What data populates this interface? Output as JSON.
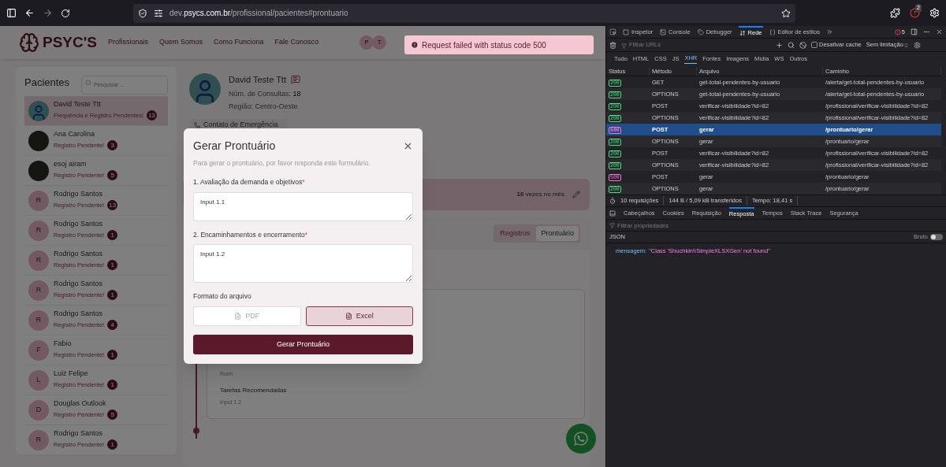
{
  "browser": {
    "url": "dev.**psycs.com.br**/profissional/pacientes#prontuario",
    "notification_count": "2"
  },
  "header": {
    "logo": "PSYC'S",
    "nav": [
      "Profissionais",
      "Quem Somos",
      "Como Funciona",
      "Fale Conosco"
    ],
    "avatars": [
      "P",
      "T"
    ]
  },
  "toast": {
    "message": "Request failed with status code 500"
  },
  "sidebar": {
    "title": "Pacientes",
    "search": {
      "placeholder": "Pesquisar ..."
    },
    "patients": [
      {
        "name": "David Teste Ttt",
        "status": "Frequência e Registro Pendentes!",
        "count": "13",
        "selected": true,
        "kind": "avatar"
      },
      {
        "name": "Ana Carolina",
        "status": "Registro Pendente!",
        "count": "3",
        "selected": false,
        "kind": "photo"
      },
      {
        "name": "esoj airam",
        "status": "Registro Pendente!",
        "count": "5",
        "selected": false,
        "kind": "photo"
      },
      {
        "name": "Rodrigo Santos",
        "status": "Registro Pendente!",
        "count": "13",
        "selected": false,
        "kind": "initial",
        "initial": "R"
      },
      {
        "name": "Rodrigo Santos",
        "status": "Registro Pendente!",
        "count": "1",
        "selected": false,
        "kind": "initial",
        "initial": "R"
      },
      {
        "name": "Rodrigo Santos",
        "status": "Registro Pendente!",
        "count": "1",
        "selected": false,
        "kind": "initial",
        "initial": "R"
      },
      {
        "name": "Rodrigo Santos",
        "status": "Registro Pendente!",
        "count": "1",
        "selected": false,
        "kind": "initial",
        "initial": "R"
      },
      {
        "name": "Rodrigo Santos",
        "status": "Registro Pendente!",
        "count": "4",
        "selected": false,
        "kind": "initial",
        "initial": "R"
      },
      {
        "name": "Fabio",
        "status": "Registro Pendente!",
        "count": "1",
        "selected": false,
        "kind": "initial",
        "initial": "F"
      },
      {
        "name": "Luiz Felipe",
        "status": "Registro Pendente!",
        "count": "1",
        "selected": false,
        "kind": "initial",
        "initial": "L"
      },
      {
        "name": "Douglas Outlook",
        "status": "Registro Pendente!",
        "count": "5",
        "selected": false,
        "kind": "initial",
        "initial": "D"
      },
      {
        "name": "Rodrigo Santos",
        "status": "Registro Pendente!",
        "count": "1",
        "selected": false,
        "kind": "initial",
        "initial": "R"
      }
    ]
  },
  "patient": {
    "name": "David Teste Ttt",
    "consultas_label": "Núm. de Consultas:",
    "consultas": "18",
    "region": "Região: Centro-Oeste",
    "emergency": "Contato de Emergência"
  },
  "frequency": {
    "count": "10",
    "label": "vezes no mês"
  },
  "tabs": [
    {
      "label": "Registros",
      "selected": false
    },
    {
      "label": "Prontuário",
      "selected": true
    }
  ],
  "record": {
    "value": "Ruim",
    "field": "Tarefas Recomendadas",
    "field_value": "Input 1.2"
  },
  "modal": {
    "title": "Gerar Prontuário",
    "subtitle": "Para gerar o prontuário, por favor responda este formulário.",
    "questions": [
      {
        "label": "1. Avaliação da demanda e objetivos",
        "required": true,
        "value": "Input 1.1"
      },
      {
        "label": "2. Encaminhamentos e encerramento",
        "required": true,
        "value": "Input 1.2"
      }
    ],
    "format_label": "Formato do arquivo",
    "formats": [
      {
        "label": "PDF",
        "selected": false
      },
      {
        "label": "Excel",
        "selected": true
      }
    ],
    "submit": "Gerar Prontuário",
    "required_mark": "*"
  },
  "devtools": {
    "tabs": [
      {
        "label": "Inspetor",
        "kind": "inspector",
        "selected": false
      },
      {
        "label": "Console",
        "kind": "console",
        "selected": false
      },
      {
        "label": "Debugger",
        "kind": "debugger",
        "selected": false
      },
      {
        "label": "Rede",
        "kind": "network",
        "selected": true
      },
      {
        "label": "Editor de estilos",
        "kind": "style",
        "selected": false
      }
    ],
    "errors": "5",
    "filter": {
      "placeholder": "Filtrar URLs"
    },
    "disable_cache": {
      "label": "Desativar cache",
      "checked": false
    },
    "throttle": "Sem limitação",
    "types": [
      {
        "label": "Tudo",
        "selected": false
      },
      {
        "label": "HTML",
        "selected": false
      },
      {
        "label": "CSS",
        "selected": false
      },
      {
        "label": "JS",
        "selected": false
      },
      {
        "label": "XHR",
        "selected": true
      },
      {
        "label": "Fontes",
        "selected": false
      },
      {
        "label": "Imagens",
        "selected": false
      },
      {
        "label": "Mídia",
        "selected": false
      },
      {
        "label": "WS",
        "selected": false
      },
      {
        "label": "Outros",
        "selected": false
      }
    ],
    "columns": [
      "Status",
      "Método",
      "Arquivo",
      "Caminho"
    ],
    "requests": [
      {
        "status": "200",
        "color": "#4ade80",
        "method": "GET",
        "file": "get-total-pendentes-by-usuario",
        "path": "/alerta/get-total-pendentes-by-usuario",
        "selected": false
      },
      {
        "status": "200",
        "color": "#4ade80",
        "method": "OPTIONS",
        "file": "get-total-pendentes-by-usuario",
        "path": "/alerta/get-total-pendentes-by-usuario",
        "selected": false
      },
      {
        "status": "200",
        "color": "#4ade80",
        "method": "POST",
        "file": "verificar-visibilidade?id=82",
        "path": "/profissional/verificar-visibilidade?id=82",
        "selected": false
      },
      {
        "status": "200",
        "color": "#4ade80",
        "method": "OPTIONS",
        "file": "verificar-visibilidade?id=82",
        "path": "/profissional/verificar-visibilidade?id=82",
        "selected": false
      },
      {
        "status": "500",
        "color": "#f472d0",
        "method": "POST",
        "file": "gerar",
        "path": "/prontuario/gerar",
        "selected": true
      },
      {
        "status": "200",
        "color": "#4ade80",
        "method": "OPTIONS",
        "file": "gerar",
        "path": "/prontuario/gerar",
        "selected": false
      },
      {
        "status": "200",
        "color": "#4ade80",
        "method": "POST",
        "file": "verificar-visibilidade?id=82",
        "path": "/profissional/verificar-visibilidade?id=82",
        "selected": false
      },
      {
        "status": "200",
        "color": "#4ade80",
        "method": "OPTIONS",
        "file": "verificar-visibilidade?id=82",
        "path": "/profissional/verificar-visibilidade?id=82",
        "selected": false
      },
      {
        "status": "500",
        "color": "#f472d0",
        "method": "POST",
        "file": "gerar",
        "path": "/prontuario/gerar",
        "selected": false
      },
      {
        "status": "200",
        "color": "#4ade80",
        "method": "OPTIONS",
        "file": "gerar",
        "path": "/prontuario/gerar",
        "selected": false
      }
    ],
    "summary": [
      "10 requisições",
      "144 B / 5,09 kB transferidos",
      "Tempo: 18,41 s"
    ],
    "detail_tabs": [
      {
        "label": "Cabeçalhos",
        "selected": false
      },
      {
        "label": "Cookies",
        "selected": false
      },
      {
        "label": "Requisição",
        "selected": false
      },
      {
        "label": "Resposta",
        "selected": true
      },
      {
        "label": "Tempos",
        "selected": false
      },
      {
        "label": "Stack Trace",
        "selected": false
      },
      {
        "label": "Segurança",
        "selected": false
      }
    ],
    "prop_filter": {
      "placeholder": "Filtrar propriedades"
    },
    "format": "JSON",
    "raw": {
      "label": "Bruto",
      "on": false
    },
    "response": [
      {
        "key": "mensagem:",
        "value": "\"Class 'Shuchkin\\\\SimpleXLSXGen' not found\""
      }
    ]
  }
}
